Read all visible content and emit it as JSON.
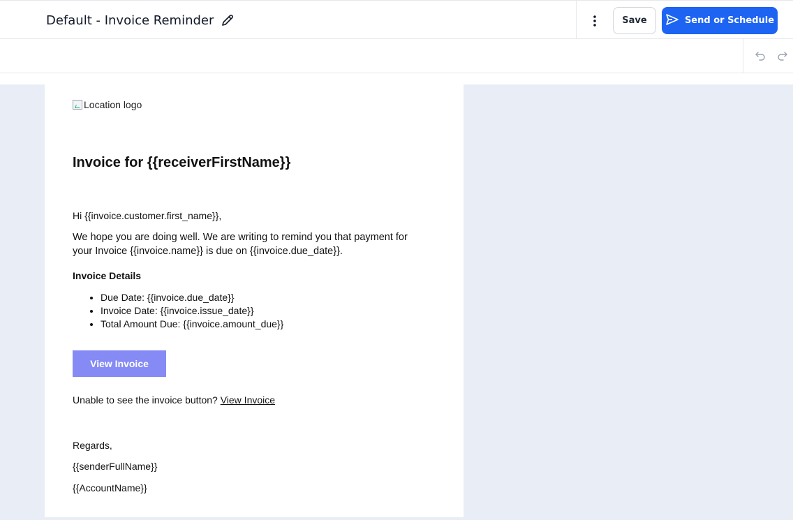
{
  "header": {
    "title": "Default - Invoice Reminder",
    "save_label": "Save",
    "send_label": "Send or Schedule"
  },
  "icons": {
    "edit": "pencil-icon",
    "more": "more-vertical-icon",
    "send": "send-icon",
    "undo": "undo-icon",
    "redo": "redo-icon"
  },
  "colors": {
    "primary": "#1d64f2",
    "canvas_bg": "#e9eef6",
    "email_button": "#858af4"
  },
  "email": {
    "logo_alt": "Location logo",
    "heading": "Invoice for {{receiverFirstName}}",
    "greeting": "Hi {{invoice.customer.first_name}},",
    "paragraph": "We hope you are doing well. We are writing to remind you that payment for your Invoice {{invoice.name}} is due on {{invoice.due_date}}.",
    "details_title": "Invoice Details",
    "details": [
      "Due Date: {{invoice.due_date}}",
      "Invoice Date: {{invoice.issue_date}}",
      "Total Amount Due: {{invoice.amount_due}}"
    ],
    "button_label": "View Invoice",
    "unable_text": "Unable to see the invoice button? ",
    "unable_link": "View Invoice",
    "regards": "Regards,",
    "sender": "{{senderFullName}}",
    "account": "{{AccountName}}"
  }
}
